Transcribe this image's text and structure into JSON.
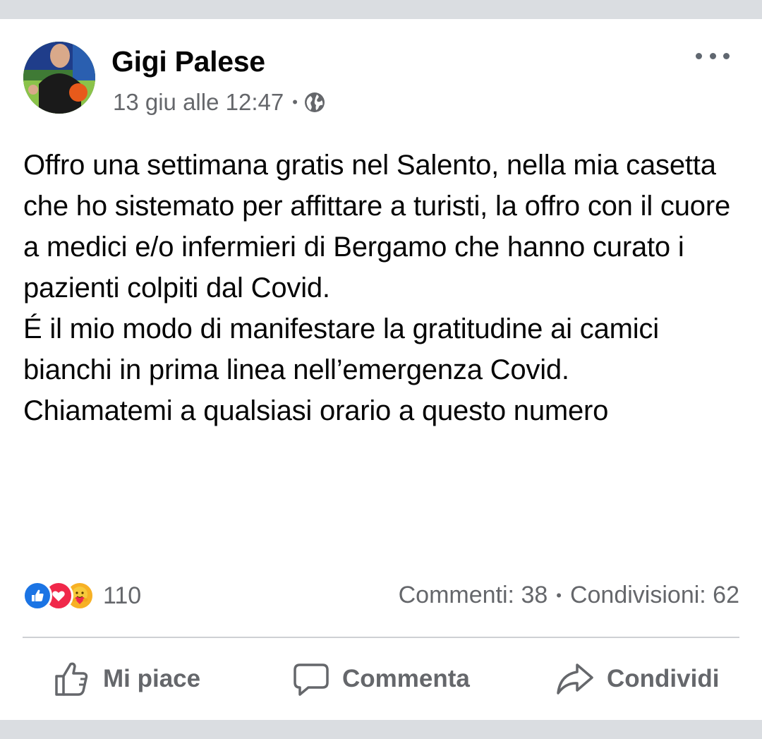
{
  "post": {
    "author": "Gigi Palese",
    "timestamp": "13 giu alle 12:47",
    "separator": "•",
    "privacy_icon": "globe-icon",
    "more_icon": "more-options-icon",
    "text": "Offro una settimana gratis nel Salento, nella mia casetta che ho sistemato per affittare a turisti, la offro con il cuore a medici e/o infermieri di Bergamo che hanno curato i pazienti colpiti dal Covid.\nÉ il mio modo di manifestare la gratitudine ai camici bianchi in prima linea nell’emergenza Covid.\nChiamatemi a qualsiasi orario a questo numero"
  },
  "reactions": {
    "icons": [
      "like-reaction-icon",
      "love-reaction-icon",
      "care-reaction-icon"
    ],
    "count": "110"
  },
  "stats": {
    "comments": "Commenti: 38",
    "separator": "•",
    "shares": "Condivisioni: 62"
  },
  "actions": {
    "like": "Mi piace",
    "comment": "Commenta",
    "share": "Condividi"
  },
  "colors": {
    "like_blue": "#1b74e4",
    "love_red": "#f0284a",
    "care_yellow": "#f7b125",
    "secondary_text": "#65676b",
    "background": "#dadde1"
  }
}
